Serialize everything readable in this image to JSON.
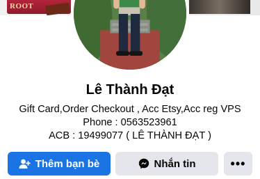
{
  "cover": {
    "left_label": "ROOT"
  },
  "profile": {
    "name": "Lê Thành Đạt",
    "bio_lines": [
      "Gift Card,Order Checkout , Acc Etsy,Acc reg VPS",
      "Phone : 0563523961",
      "ACB : 19499077 ( LÊ THÀNH ĐẠT )"
    ]
  },
  "actions": {
    "add_friend_label": "Thêm bạn bè",
    "add_friend_icon": "add-friend-icon",
    "message_label": "Nhắn tin",
    "message_icon": "messenger-icon",
    "more_icon": "more-dots-icon",
    "more_label": "•••"
  },
  "colors": {
    "primary_button": "#1b74e4",
    "secondary_button": "#e4e6eb",
    "text": "#050505"
  }
}
